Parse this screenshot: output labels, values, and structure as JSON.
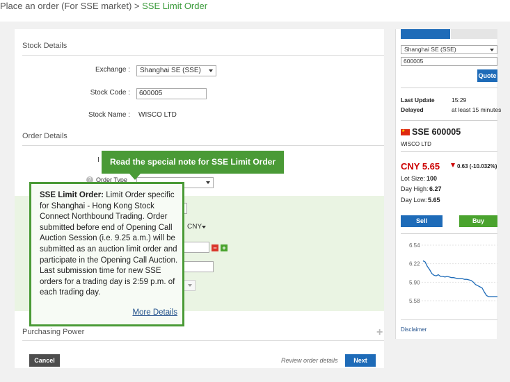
{
  "breadcrumb": {
    "part1": "Place an order (For SSE market)",
    "sep": ">",
    "part2": "SSE Limit Order"
  },
  "stock_details": {
    "header": "Stock Details",
    "exchange_label": "Exchange :",
    "exchange_value": "Shanghai SE (SSE)",
    "code_label": "Stock Code :",
    "code_value": "600005",
    "name_label": "Stock Name :",
    "name_value": "WISCO LTD"
  },
  "order_details": {
    "header": "Order Details",
    "order_type_label": "Order Type",
    "currency_value": "CNY"
  },
  "tooltip": {
    "text": "Read the special note for SSE Limit Order"
  },
  "popup": {
    "title": "SSE Limit Order:",
    "body": "Limit Order specific for Shanghai - Hong Kong Stock Connect Northbound Trading. Order submitted before end of Opening Call Auction Session (i.e. 9.25 a.m.) will be submitted as an auction limit order and participate in the Opening Call Auction. Last submission time for new SSE orders for a trading day is 2:59 p.m. of each trading day.",
    "more_link": "More Details"
  },
  "purchasing_power": {
    "label": "Purchasing Power",
    "plus": "+"
  },
  "footer": {
    "cancel": "Cancel",
    "review": "Review order details",
    "next": "Next"
  },
  "sidebar": {
    "exchange_value": "Shanghai SE (SSE)",
    "code_value": "600005",
    "quote_button": "Quote",
    "last_update_label": "Last Update",
    "last_update_value": "15:29",
    "delayed_label": "Delayed",
    "delayed_value": "at least 15 minutes",
    "stock_title": "SSE 600005",
    "stock_name": "WISCO LTD",
    "price": "CNY 5.65",
    "change": "0.63 (-10.032%)",
    "lot_size": "Lot Size:",
    "lot_size_value": "100",
    "day_high": "Day High:",
    "day_high_value": "6.27",
    "day_low": "Day Low:",
    "day_low_value": "5.65",
    "sell": "Sell",
    "buy": "Buy",
    "disclaimer": "Disclaimer",
    "colors": {
      "price": "#cc0000",
      "sell": "#1e6bb8",
      "buy": "#4aa32e",
      "quote": "#1e6bb8",
      "line": "#1e6bb8"
    }
  },
  "chart_data": {
    "type": "line",
    "yticks": [
      "6.54",
      "6.22",
      "5.90",
      "5.58"
    ],
    "ylim": [
      5.58,
      6.54
    ],
    "values": [
      6.27,
      6.25,
      6.17,
      6.12,
      6.05,
      6.02,
      6.01,
      6.03,
      6.0,
      6.0,
      5.99,
      6.0,
      5.99,
      5.98,
      5.98,
      5.97,
      5.96,
      5.96,
      5.96,
      5.95,
      5.95,
      5.94,
      5.93,
      5.9,
      5.86,
      5.84,
      5.82,
      5.8,
      5.73,
      5.67,
      5.65,
      5.65,
      5.65,
      5.65,
      5.65
    ]
  }
}
